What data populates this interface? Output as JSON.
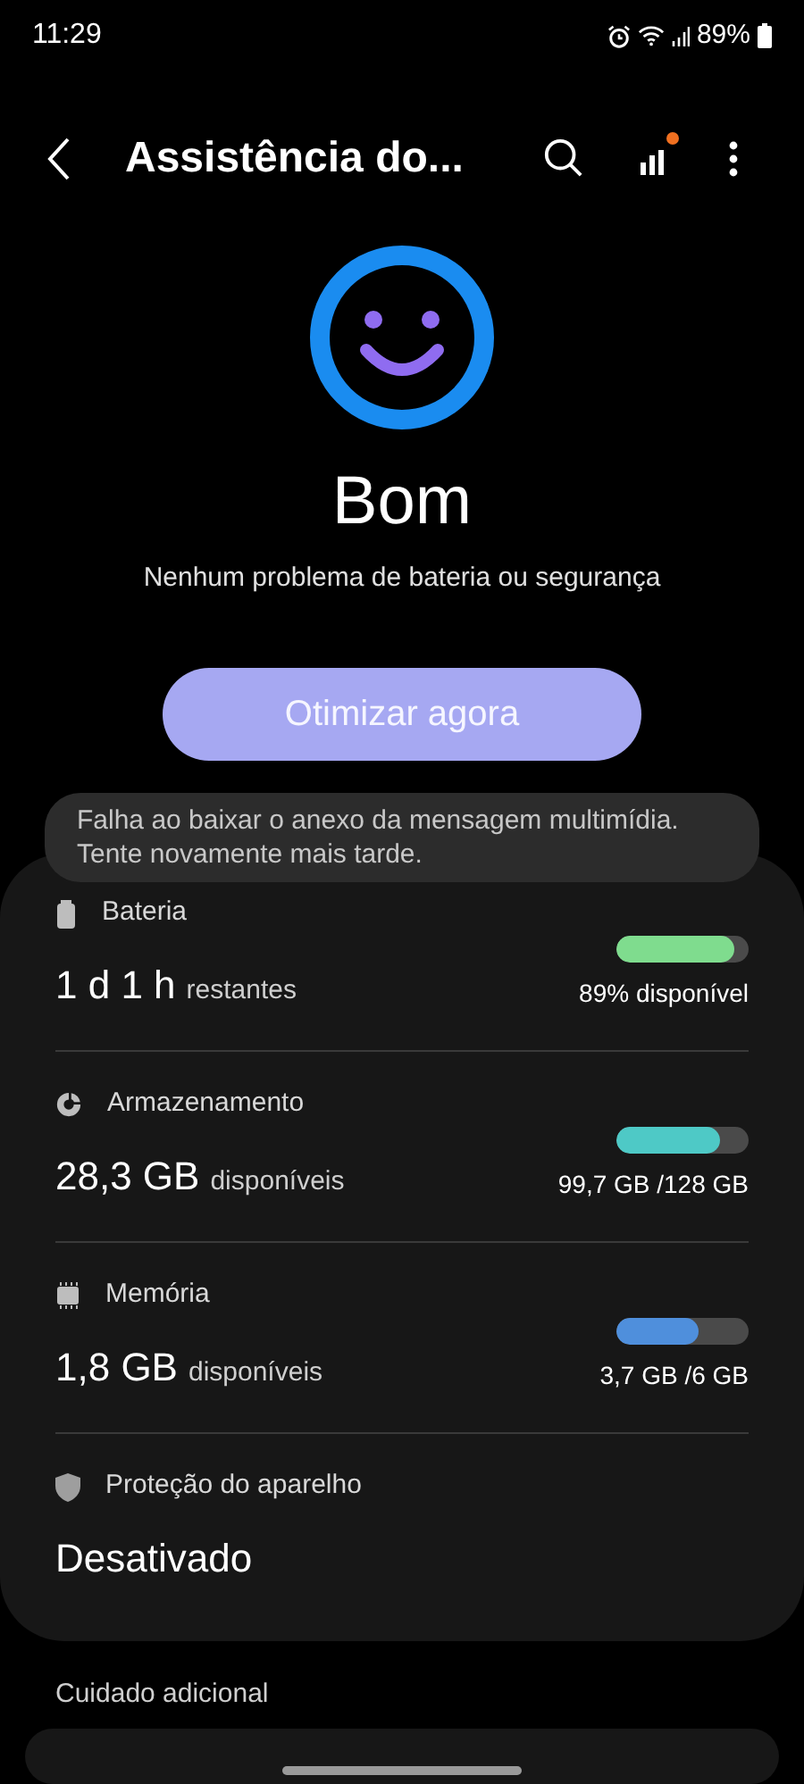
{
  "status_bar": {
    "time": "11:29",
    "battery": "89%"
  },
  "header": {
    "title": "Assistência do...",
    "has_notification": true
  },
  "status": {
    "title": "Bom",
    "subtitle": "Nenhum problema de bateria ou segurança"
  },
  "optimize_button": "Otimizar agora",
  "items": [
    {
      "kind": "meter",
      "label": "Bateria",
      "value": "1 d 1 h",
      "unit": "restantes",
      "level": 0.89,
      "color": "#7fdc8e",
      "reading": "89% disponível"
    },
    {
      "kind": "meter",
      "label": "Armazenamento",
      "value": "28,3 GB",
      "unit": "disponíveis",
      "level": 0.78,
      "color": "#4ec9c6",
      "reading": "99,7 GB /128 GB"
    },
    {
      "kind": "meter",
      "label": "Memória",
      "value": "1,8 GB",
      "unit": "disponíveis",
      "level": 0.62,
      "color": "#4f8fdc",
      "reading": "3,7 GB /6 GB"
    },
    {
      "kind": "status",
      "label": "Proteção do aparelho",
      "value": "Desativado"
    }
  ],
  "section_title": "Cuidado adicional",
  "toast": "Falha ao baixar o anexo da mensagem multimídia. Tente novamente mais tarde."
}
